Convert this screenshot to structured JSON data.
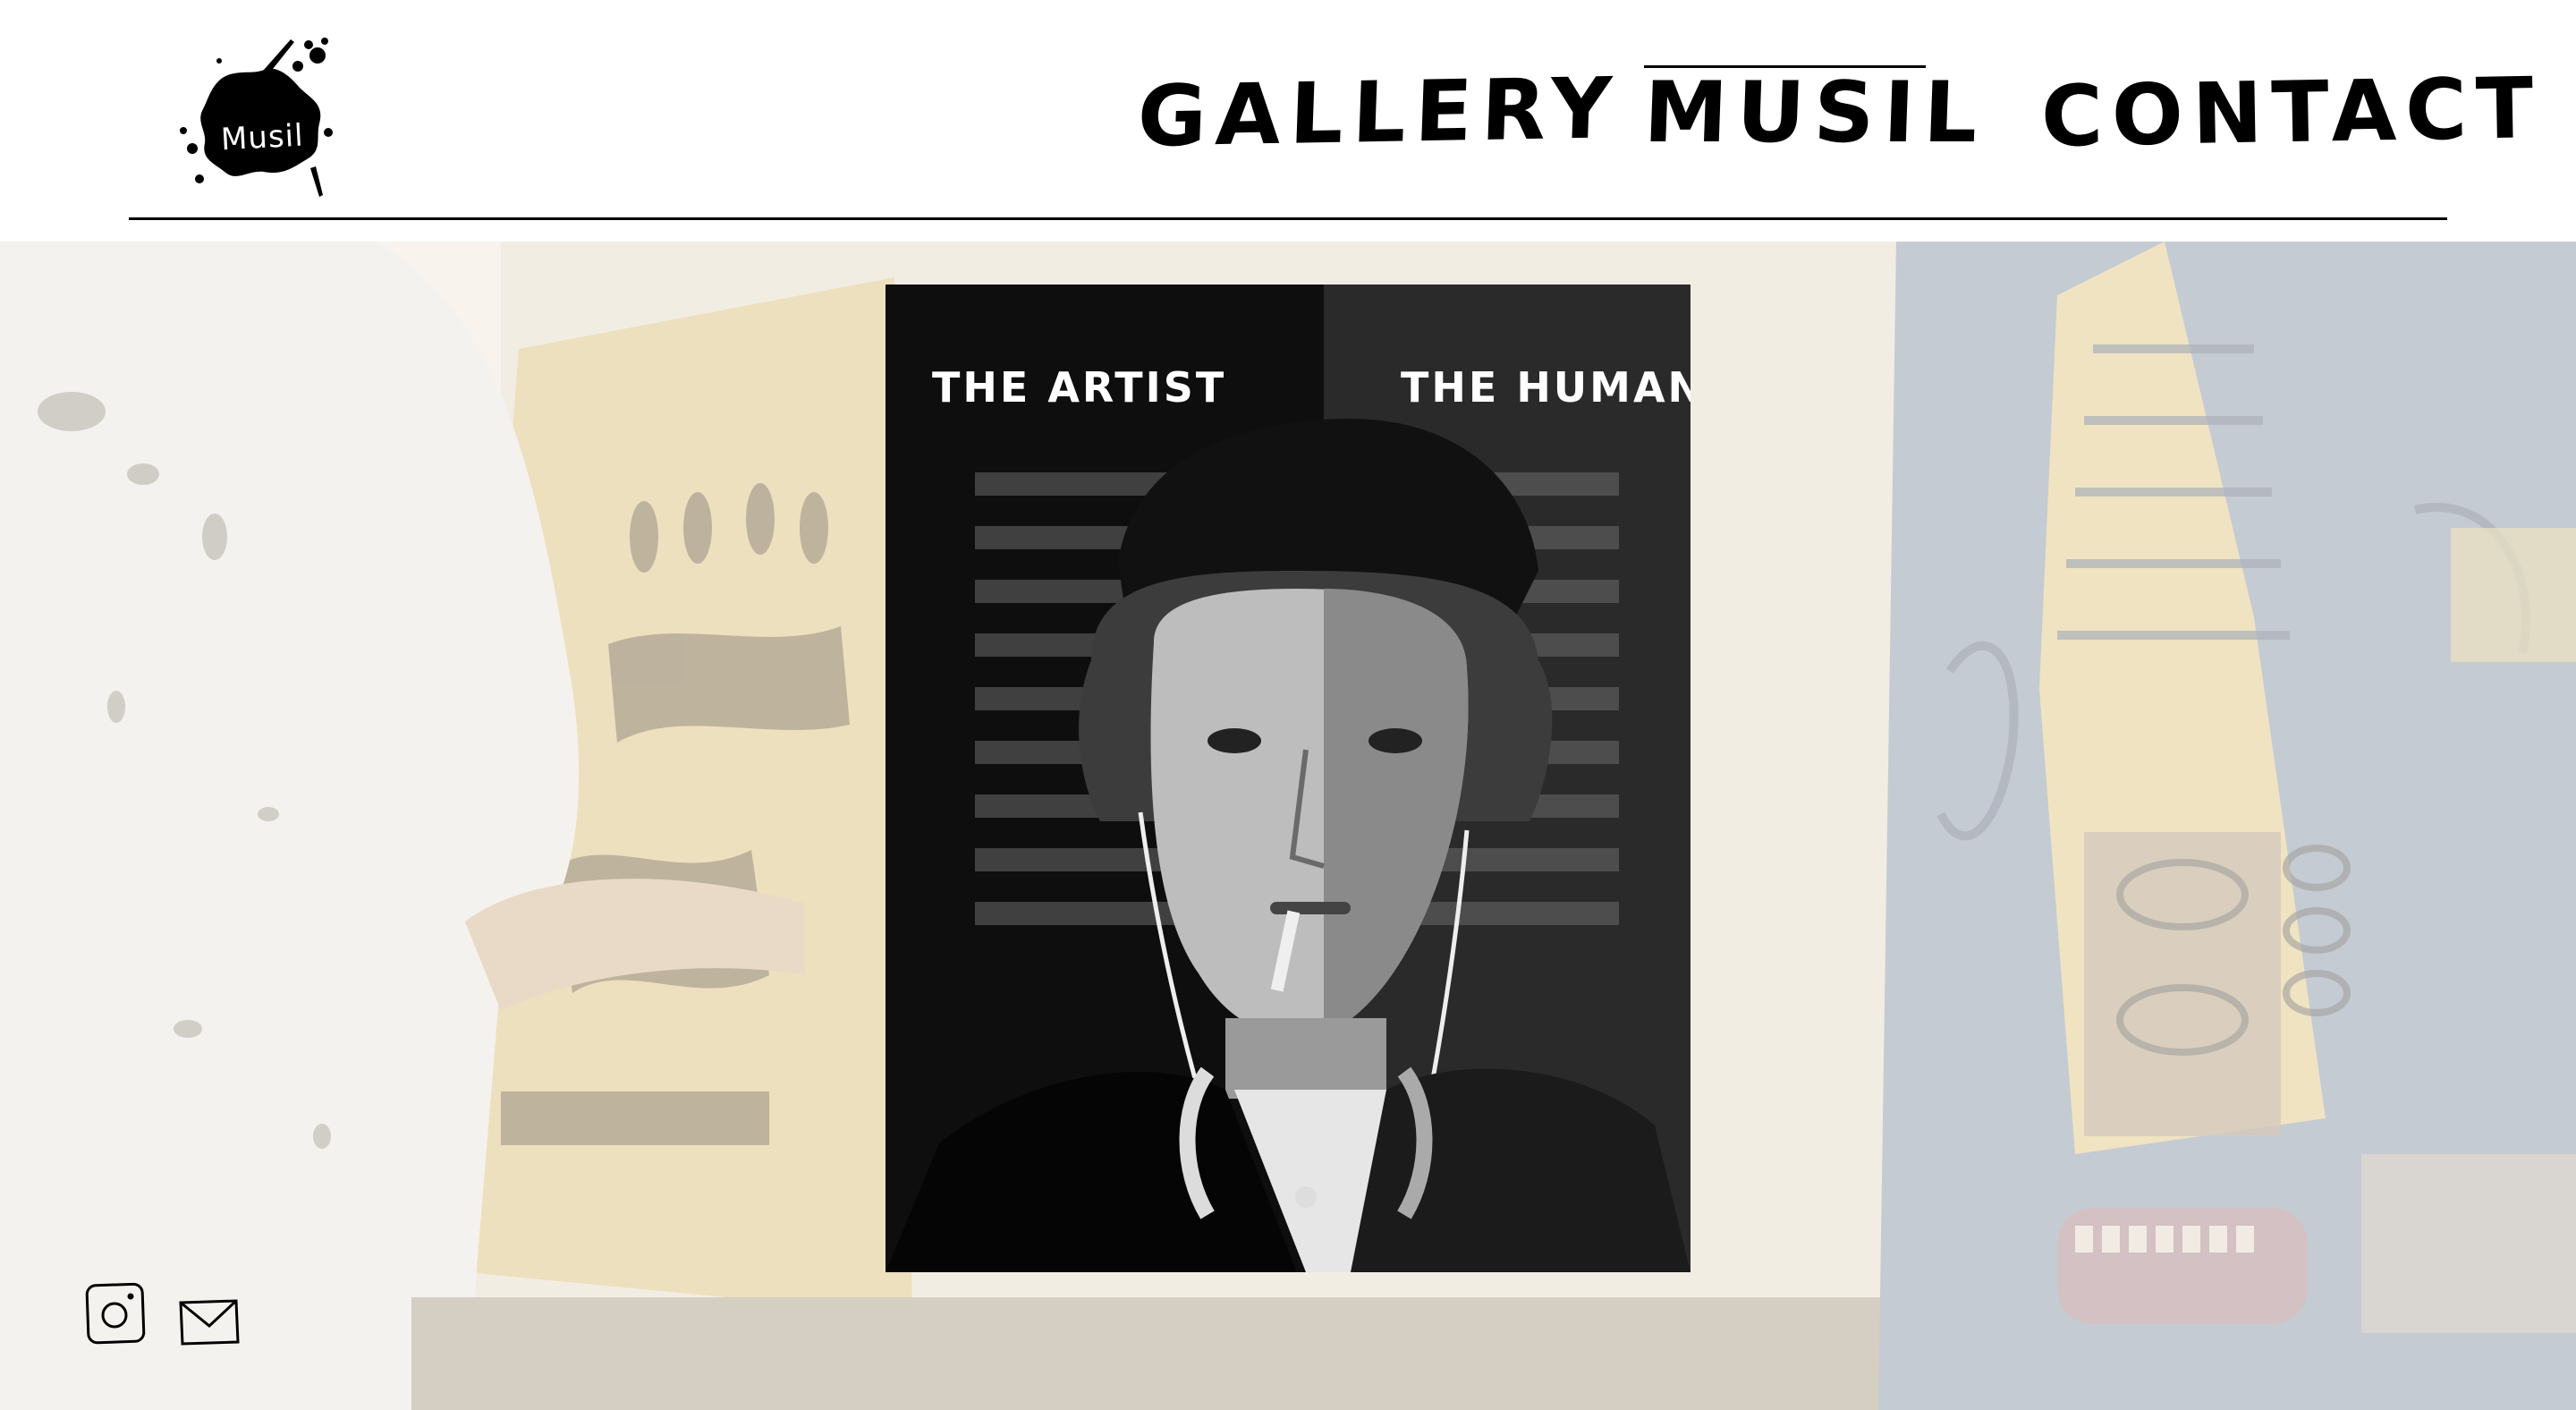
{
  "header": {
    "logo_text": "Musil",
    "nav": [
      {
        "label": "GALLERY",
        "active": false
      },
      {
        "label": "MUSIL",
        "active": true
      },
      {
        "label": "CONTACT",
        "active": false
      }
    ]
  },
  "poster": {
    "label_left": "THE ARTIST",
    "label_right": "THE HUMAN"
  },
  "social": {
    "instagram_icon": "instagram-icon",
    "email_icon": "envelope-icon"
  },
  "colors": {
    "text": "#000000",
    "background": "#ffffff",
    "poster_bg": "#141414"
  }
}
